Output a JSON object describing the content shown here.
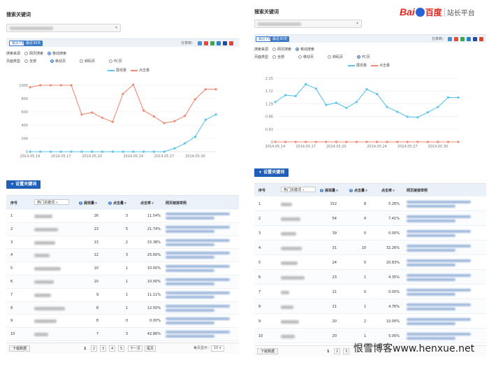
{
  "left": {
    "section_title": "搜索关键词",
    "tabs": [
      "最近7天",
      "最近30天"
    ],
    "share_label": "分享到：",
    "filters": [
      {
        "label": "搜索来源",
        "options": [
          "网页搜索",
          "移动搜索"
        ],
        "selected": 1
      },
      {
        "label": "页面类型",
        "options": [
          "全部",
          "移动页",
          "转码页",
          "PC页"
        ],
        "selected": 1
      }
    ],
    "legend": [
      "展现量",
      "点击量"
    ],
    "add_keyword_button": "+ 设置关键词",
    "table": {
      "headers": [
        "序号",
        "热门关键词",
        "展现量",
        "点击量",
        "点击率",
        "网页链接举例"
      ],
      "rows": [
        [
          "1",
          "26",
          "3",
          "11.54%"
        ],
        [
          "2",
          "23",
          "5",
          "21.74%"
        ],
        [
          "3",
          "13",
          "2",
          "15.38%"
        ],
        [
          "4",
          "12",
          "3",
          "25.00%"
        ],
        [
          "5",
          "10",
          "1",
          "10.00%"
        ],
        [
          "6",
          "10",
          "1",
          "10.00%"
        ],
        [
          "7",
          "9",
          "1",
          "11.11%"
        ],
        [
          "8",
          "8",
          "1",
          "12.50%"
        ],
        [
          "9",
          "8",
          "0",
          "0.00%"
        ],
        [
          "10",
          "7",
          "3",
          "42.86%"
        ]
      ]
    },
    "pager": {
      "download": "下载数据",
      "pages": [
        "1",
        "2",
        "3",
        "4",
        "5"
      ],
      "next": "下一页",
      "last": "尾页",
      "per_page_label": "每页显示：",
      "per_page_value": "10"
    }
  },
  "right": {
    "section_title": "搜索关键词",
    "tabs": [
      "最近7天",
      "最近30天"
    ],
    "share_label": "分享到：",
    "filters": [
      {
        "label": "搜索来源",
        "options": [
          "网页搜索",
          "移动搜索"
        ],
        "selected": 1
      },
      {
        "label": "页面类型",
        "options": [
          "全部",
          "移动页",
          "转码页",
          "PC页"
        ],
        "selected": 3
      }
    ],
    "legend": [
      "展现量",
      "点击量"
    ],
    "add_keyword_button": "+ 设置关键词",
    "table": {
      "headers": [
        "序号",
        "热门关键词",
        "展现量",
        "点击量",
        "点击率",
        "网页链接举例"
      ],
      "rows": [
        [
          "1",
          "152",
          "8",
          "5.26%"
        ],
        [
          "2",
          "54",
          "4",
          "7.41%"
        ],
        [
          "3",
          "39",
          "0",
          "0.00%"
        ],
        [
          "4",
          "31",
          "10",
          "32.26%"
        ],
        [
          "5",
          "24",
          "5",
          "20.83%"
        ],
        [
          "6",
          "23",
          "1",
          "4.35%"
        ],
        [
          "7",
          "21",
          "0",
          "0.00%"
        ],
        [
          "8",
          "21",
          "1",
          "4.76%"
        ],
        [
          "9",
          "20",
          "2",
          "10.00%"
        ],
        [
          "10",
          "20",
          "1",
          "5.00%"
        ]
      ]
    },
    "pager": {
      "download": "下载数据",
      "pages": [
        "1",
        "2",
        "3"
      ]
    }
  },
  "logo": {
    "brand": "Bai",
    "brand2": "百度",
    "platform": "站长平台"
  },
  "watermark": "恨雪博客www.henxue.net",
  "colors": {
    "accent": "#3b78c6",
    "impressions": "#5bc4ee",
    "clicks": "#ef8a73",
    "button": "#1f5fb8"
  },
  "chart_data": [
    {
      "type": "line",
      "x": [
        "2014.05.14",
        "2014.05.15",
        "2014.05.16",
        "2014.05.17",
        "2014.05.18",
        "2014.05.19",
        "2014.05.20",
        "2014.05.21",
        "2014.05.22",
        "2014.05.23",
        "2014.05.24",
        "2014.05.25",
        "2014.05.26",
        "2014.05.27",
        "2014.05.28",
        "2014.05.29",
        "2014.05.30",
        "2014.05.31",
        "2014.06.01"
      ],
      "x_tick_labels": [
        "2014.05.14",
        "2014.05.17",
        "2014.05.20",
        "2014.05.24",
        "2014.05.27",
        "2014.05.30"
      ],
      "y_tick_labels": [
        "0",
        "200",
        "400",
        "600",
        "800",
        "1000"
      ],
      "ylim": [
        0,
        1000
      ],
      "series": [
        {
          "name": "展现量",
          "values": [
            0,
            0,
            0,
            0,
            0,
            0,
            0,
            0,
            0,
            0,
            0,
            0,
            0,
            0,
            50,
            125,
            225,
            480,
            560
          ]
        },
        {
          "name": "点击量",
          "values": [
            970,
            1000,
            1000,
            1000,
            1000,
            560,
            590,
            510,
            450,
            870,
            1010,
            620,
            530,
            430,
            460,
            540,
            790,
            940,
            940
          ]
        }
      ]
    },
    {
      "type": "line",
      "x": [
        "2014.05.14",
        "2014.05.15",
        "2014.05.16",
        "2014.05.17",
        "2014.05.18",
        "2014.05.19",
        "2014.05.20",
        "2014.05.21",
        "2014.05.22",
        "2014.05.23",
        "2014.05.24",
        "2014.05.25",
        "2014.05.26",
        "2014.05.27",
        "2014.05.28",
        "2014.05.29",
        "2014.05.30",
        "2014.05.31",
        "2014.06.01"
      ],
      "x_tick_labels": [
        "2014.05.14",
        "2014.05.17",
        "2014.05.20",
        "2014.05.24",
        "2014.05.27",
        "2014.05.30"
      ],
      "y_tick_labels": [
        "0",
        "0.43",
        "0.86",
        "1.29",
        "1.72",
        "2.15"
      ],
      "ylim": [
        0,
        2.15
      ],
      "series": [
        {
          "name": "展现量",
          "values": [
            1.35,
            1.58,
            1.55,
            1.95,
            1.8,
            1.25,
            1.32,
            1.15,
            1.35,
            1.78,
            1.62,
            1.18,
            1.02,
            0.85,
            0.83,
            1.0,
            1.18,
            1.5,
            1.5
          ]
        },
        {
          "name": "点击量",
          "values": [
            0,
            0,
            0,
            0,
            0,
            0,
            0,
            0,
            0,
            0,
            0,
            0,
            0,
            0,
            0,
            0,
            0,
            0,
            0
          ]
        }
      ]
    }
  ]
}
